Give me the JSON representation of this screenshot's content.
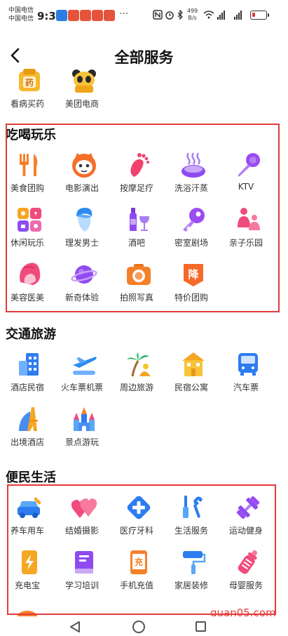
{
  "status_bar": {
    "carrier_1": "中国电信",
    "carrier_2": "中国电信",
    "time": "9:31",
    "net_speed_value": "499",
    "net_speed_unit": "B/s",
    "notifications": [
      "app-blue-icon",
      "app-red-icon",
      "app-red-icon",
      "app-red-icon",
      "app-red-icon"
    ],
    "more": "···",
    "battery_level": 0.15
  },
  "header": {
    "title": "全部服务"
  },
  "medical": {
    "items": [
      {
        "label": "看病买药",
        "icon": "medicine-icon",
        "badge": "药"
      },
      {
        "label": "美团电商",
        "icon": "panda-icon"
      }
    ]
  },
  "entertainment": {
    "title": "吃喝玩乐",
    "items": [
      {
        "label": "美食团购",
        "icon": "fork-knife-icon"
      },
      {
        "label": "电影演出",
        "icon": "cat-icon"
      },
      {
        "label": "按摩足疗",
        "icon": "foot-icon"
      },
      {
        "label": "洗浴汗蒸",
        "icon": "bath-icon"
      },
      {
        "label": "KTV",
        "icon": "microphone-icon"
      },
      {
        "label": "休闲玩乐",
        "icon": "leisure-icon"
      },
      {
        "label": "理发男士",
        "icon": "barber-icon"
      },
      {
        "label": "酒吧",
        "icon": "wine-icon"
      },
      {
        "label": "密室剧场",
        "icon": "key-icon"
      },
      {
        "label": "亲子乐园",
        "icon": "family-icon"
      },
      {
        "label": "美容医美",
        "icon": "beauty-icon"
      },
      {
        "label": "新奇体验",
        "icon": "planet-icon"
      },
      {
        "label": "拍照写真",
        "icon": "camera-icon"
      },
      {
        "label": "特价团购",
        "icon": "discount-icon",
        "badge": "降"
      }
    ]
  },
  "travel": {
    "title": "交通旅游",
    "items": [
      {
        "label": "酒店民宿",
        "icon": "hotel-icon"
      },
      {
        "label": "火车票机票",
        "icon": "plane-icon"
      },
      {
        "label": "周边旅游",
        "icon": "palm-tree-icon"
      },
      {
        "label": "民宿公寓",
        "icon": "apartment-icon"
      },
      {
        "label": "汽车票",
        "icon": "bus-icon"
      },
      {
        "label": "出境酒店",
        "icon": "eiffel-tower-icon"
      },
      {
        "label": "景点游玩",
        "icon": "castle-icon"
      }
    ]
  },
  "life": {
    "title": "便民生活",
    "items": [
      {
        "label": "养车用车",
        "icon": "car-service-icon"
      },
      {
        "label": "结婚摄影",
        "icon": "hearts-icon"
      },
      {
        "label": "医疗牙科",
        "icon": "medical-cross-icon"
      },
      {
        "label": "生活服务",
        "icon": "tools-icon"
      },
      {
        "label": "运动健身",
        "icon": "dumbbell-icon"
      },
      {
        "label": "充电宝",
        "icon": "power-bank-icon"
      },
      {
        "label": "学习培训",
        "icon": "book-icon"
      },
      {
        "label": "手机充值",
        "icon": "phone-recharge-icon",
        "badge": "充"
      },
      {
        "label": "家居装修",
        "icon": "paint-roller-icon"
      },
      {
        "label": "母婴服务",
        "icon": "baby-bottle-icon"
      }
    ]
  },
  "watermark": "quan05.com",
  "colors": {
    "highlight_border": "#e23a3a",
    "accent_orange": "#f5a623",
    "accent_blue": "#2d7cf0",
    "accent_purple": "#8e4cf0",
    "accent_pink": "#f04b7c"
  }
}
